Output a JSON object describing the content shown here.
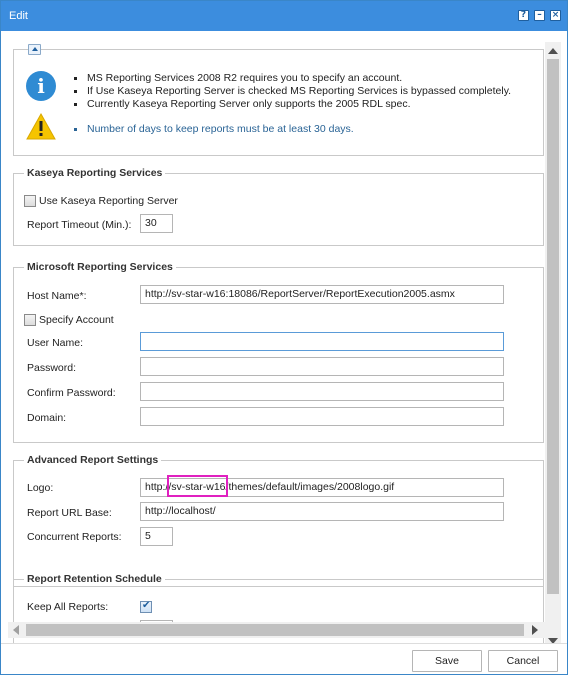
{
  "window": {
    "title": "Edit",
    "help_icon": "help-icon",
    "minimize_icon": "minimize-icon",
    "close_icon": "close-icon"
  },
  "notes": {
    "bullets": [
      "MS Reporting Services 2008 R2 requires you to specify an account.",
      "If Use Kaseya Reporting Server is checked MS Reporting Services is bypassed completely.",
      "Currently Kaseya Reporting Server only supports the 2005 RDL spec."
    ],
    "warning": "Number of days to keep reports must be at least 30 days."
  },
  "kaseya": {
    "legend": "Kaseya Reporting Services",
    "use_server_label": "Use Kaseya Reporting Server",
    "use_server_checked": false,
    "timeout_label": "Report Timeout (Min.):",
    "timeout_value": "30"
  },
  "microsoft": {
    "legend": "Microsoft Reporting Services",
    "host_label": "Host Name*:",
    "host_value": "http://sv-star-w16:18086/ReportServer/ReportExecution2005.asmx",
    "specify_account_label": "Specify Account",
    "specify_account_checked": false,
    "username_label": "User Name:",
    "username_value": "",
    "password_label": "Password:",
    "confirm_password_label": "Confirm Password:",
    "domain_label": "Domain:"
  },
  "advanced": {
    "legend": "Advanced Report Settings",
    "logo_label": "Logo:",
    "logo_value": "http://sv-star-w16/themes/default/images/2008logo.gif",
    "url_base_label": "Report URL Base:",
    "url_base_value": "http://localhost/",
    "concurrent_label": "Concurrent Reports:",
    "concurrent_value": "5"
  },
  "retention": {
    "legend": "Report Retention Schedule",
    "keep_all_label": "Keep All Reports:",
    "keep_all_checked": true
  },
  "footer": {
    "save_label": "Save",
    "cancel_label": "Cancel"
  },
  "colors": {
    "titlebar": "#3c8dde",
    "highlight": "#e020c0",
    "note_text": "#2a6496"
  }
}
